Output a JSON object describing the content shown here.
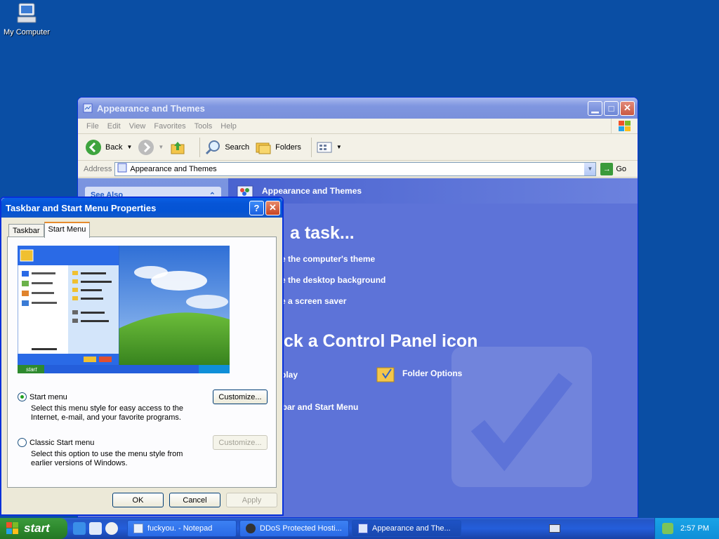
{
  "desktop": {
    "icon_label": "My Computer"
  },
  "explorer": {
    "title": "Appearance and Themes",
    "menu": [
      "File",
      "Edit",
      "View",
      "Favorites",
      "Tools",
      "Help"
    ],
    "toolbar": {
      "back": "Back",
      "search": "Search",
      "folders": "Folders"
    },
    "address_label": "Address",
    "address_value": "Appearance and Themes",
    "go": "Go",
    "sidebar_heading": "See Also",
    "header": "Appearance and Themes",
    "pick_task": "a task...",
    "tasks": [
      "e the computer's theme",
      "e the desktop background",
      "e a screen saver"
    ],
    "pick_icon": "ick a Control Panel icon",
    "cp_items": [
      "play",
      "Folder Options",
      "kbar and Start Menu"
    ]
  },
  "dialog": {
    "title": "Taskbar and Start Menu Properties",
    "help": "?",
    "tabs": [
      "Taskbar",
      "Start Menu"
    ],
    "option1_label": "Start menu",
    "option1_desc": "Select this menu style for easy access to the Internet, e-mail, and your favorite programs.",
    "option2_label": "Classic Start menu",
    "option2_desc": "Select this option to use the menu style from earlier versions of Windows.",
    "customize": "Customize...",
    "ok": "OK",
    "cancel": "Cancel",
    "apply": "Apply",
    "preview_start": "start"
  },
  "taskbar": {
    "start": "start",
    "tasks": [
      "fuckyou. - Notepad",
      "DDoS Protected Hosti...",
      "Appearance and The..."
    ],
    "clock": "2:57 PM"
  }
}
